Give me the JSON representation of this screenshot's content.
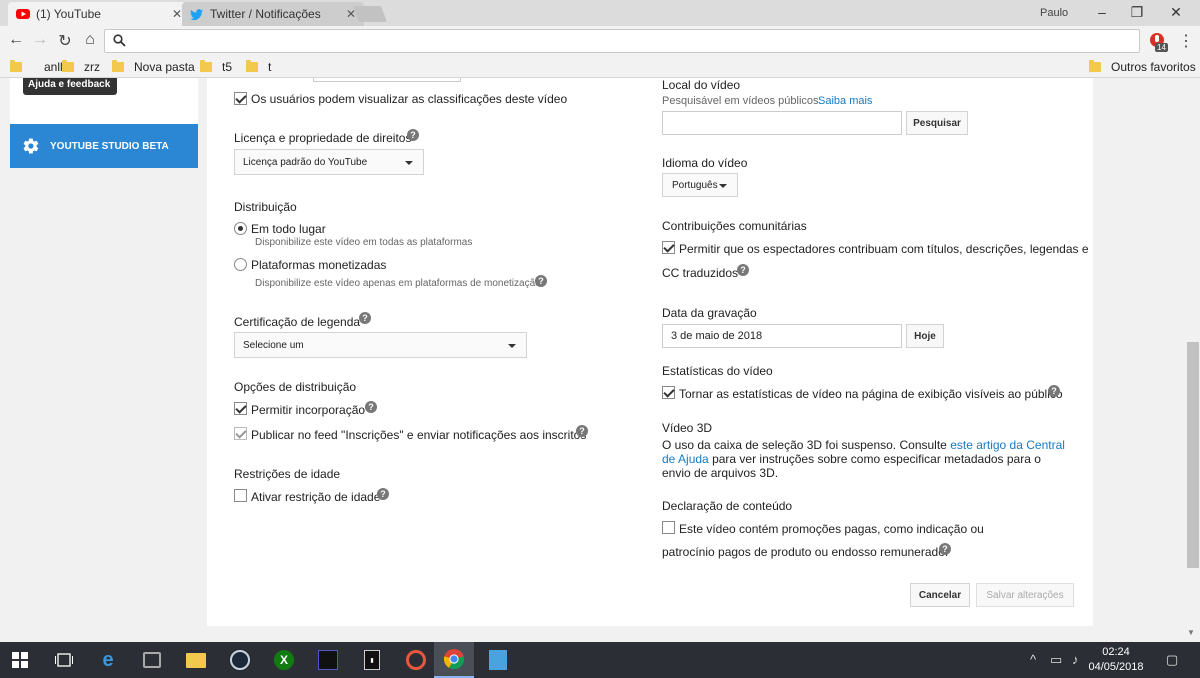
{
  "browser": {
    "tabs": [
      {
        "title": "(1) YouTube",
        "icon": "youtube-icon"
      },
      {
        "title": "Twitter / Notificações",
        "icon": "twitter-icon"
      }
    ],
    "profile_name": "Paulo",
    "extension_badge": "14",
    "bookmarks": [
      "anll",
      "zrz",
      "Nova pasta",
      "t5",
      "t"
    ],
    "other_bookmarks": "Outros favoritos"
  },
  "sidebar": {
    "tooltip": "Ajuda e feedback",
    "studio_button": "YOUTUBE STUDIO BETA"
  },
  "left": {
    "ratings_visible_label": "Os usuários podem visualizar as classificações deste vídeo",
    "license_heading": "Licença e propriedade de direitos",
    "license_value": "Licença padrão do YouTube",
    "distribution_heading": "Distribuição",
    "distribution_everywhere": "Em todo lugar",
    "distribution_everywhere_desc": "Disponibilize este vídeo em todas as plataformas",
    "distribution_monetized": "Plataformas monetizadas",
    "distribution_monetized_desc": "Disponibilize este vídeo apenas em plataformas de monetização",
    "caption_heading": "Certificação de legenda",
    "caption_value": "Selecione um",
    "dist_options_heading": "Opções de distribuição",
    "allow_embedding": "Permitir incorporação",
    "publish_feed": "Publicar no feed \"Inscrições\" e enviar notificações aos inscritos",
    "age_heading": "Restrições de idade",
    "age_label": "Ativar restrição de idade"
  },
  "right": {
    "location_heading": "Local do vídeo",
    "location_desc": "Pesquisável em vídeos públicos.",
    "learn_more": "Saiba mais",
    "search_button": "Pesquisar",
    "language_heading": "Idioma do vídeo",
    "language_value": "Português",
    "community_heading": "Contribuições comunitárias",
    "community_label_line1": "Permitir que os espectadores contribuam com títulos, descrições, legendas e",
    "community_label_line2": "CC traduzidos",
    "recording_heading": "Data da gravação",
    "recording_value": "3 de maio de 2018",
    "today_button": "Hoje",
    "stats_heading": "Estatísticas do vídeo",
    "stats_label": "Tornar as estatísticas de vídeo na página de exibição visíveis ao público",
    "v3d_heading": "Vídeo 3D",
    "v3d_text_1": "O uso da caixa de seleção 3D foi suspenso. Consulte",
    "v3d_link": "este artigo da Central de Ajuda",
    "v3d_text_2": "para ver instruções sobre como especificar metadados para o envio de arquivos 3D.",
    "content_heading": "Declaração de conteúdo",
    "content_label_line1": "Este vídeo contém promoções pagas, como indicação ou",
    "content_label_line2": "patrocínio pagos de produto ou endosso remunerado."
  },
  "footer": {
    "cancel": "Cancelar",
    "save": "Salvar alterações"
  },
  "taskbar": {
    "time": "02:24",
    "date": "04/05/2018"
  },
  "colors": {
    "accent": "#2b86d4",
    "link": "#167ac6",
    "youtube_red": "#ff0000",
    "twitter_blue": "#1da1f2"
  }
}
